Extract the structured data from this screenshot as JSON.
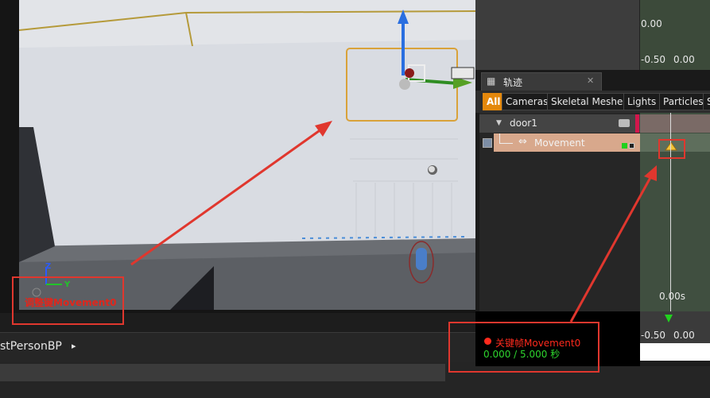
{
  "viewport": {
    "axis_z": "Z",
    "axis_y": "Y",
    "key_label": "调整键Movement0"
  },
  "blueprint_bar": {
    "label": "stPersonBP",
    "arrow": "▸"
  },
  "curve_editor": {
    "tick_top": "0.00",
    "tick_bottom_a": "-0.50",
    "tick_bottom_b": "0.00"
  },
  "sequencer": {
    "tab_icon": "▦",
    "tab_label": "轨迹",
    "tab_close": "✕",
    "filters": [
      "All",
      "Cameras",
      "Skeletal Meshes",
      "Lights",
      "Particles",
      "S"
    ],
    "track_door": "door1",
    "track_movement": "Movement",
    "time_marker": "0.00s",
    "bottom_tick_a": "-0.50",
    "bottom_tick_b": "0.00"
  },
  "status": {
    "keyframe": "关键帧Movement0",
    "time": "0.000 / 5.000 秒"
  },
  "colors": {
    "accent": "#e4880c",
    "annotation": "#e0372e",
    "status_green": "#2ed62e",
    "door_marker": "#d3174c"
  }
}
